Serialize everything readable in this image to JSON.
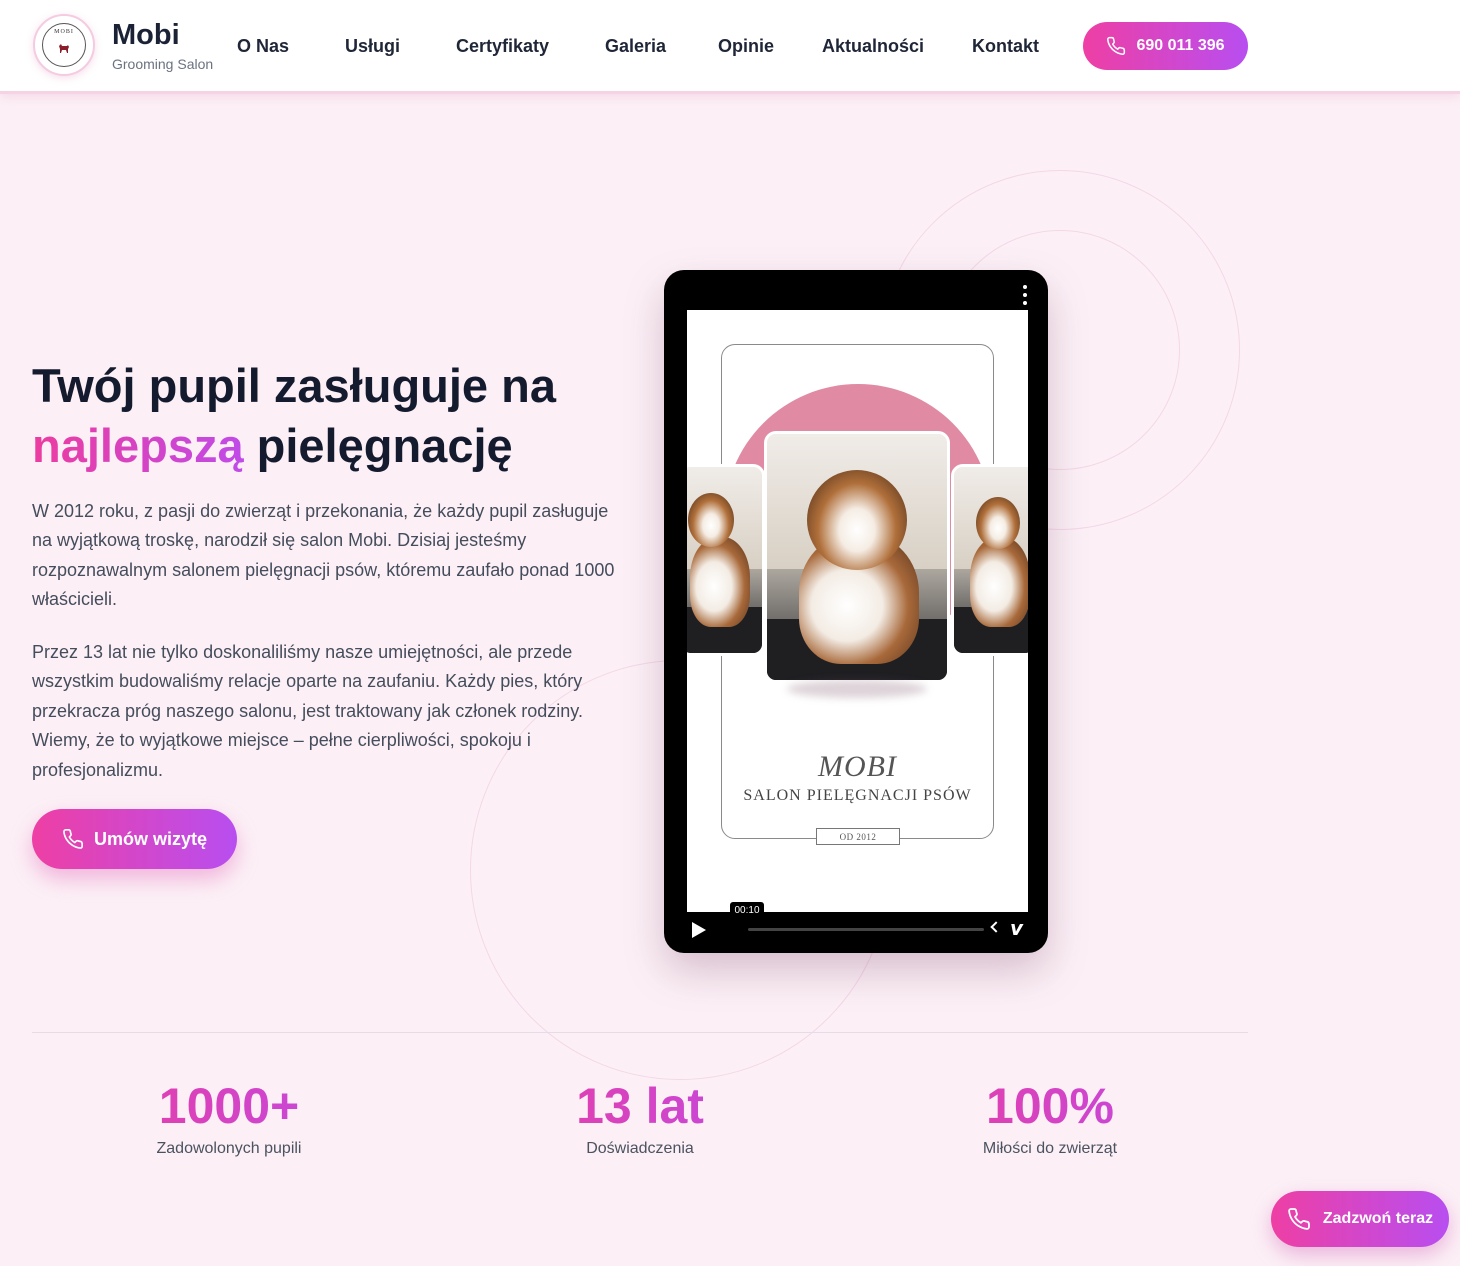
{
  "header": {
    "brand_name": "Mobi",
    "brand_sub": "Grooming Salon",
    "logo_text": "MOBI",
    "nav": [
      "O Nas",
      "Usługi",
      "Certyfikaty",
      "Galeria",
      "Opinie",
      "Aktualności",
      "Kontakt"
    ],
    "phone_label": "690 011 396",
    "phone_icon": "phone-icon"
  },
  "hero": {
    "title_line1": "Twój pupil zasługuje na",
    "title_accent": "najlepszą",
    "title_rest": " pielęgnację",
    "paragraph1": "W 2012 roku, z pasji do zwierząt i przekonania, że każdy pupil zasługuje na wyjątkową troskę, narodził się salon Mobi. Dzisiaj jesteśmy rozpoznawalnym salonem pielęgnacji psów, któremu zaufało ponad 1000 właścicieli.",
    "paragraph2": "Przez 13 lat nie tylko doskonaliliśmy nasze umiejętności, ale przede wszystkim budowaliśmy relacje oparte na zaufaniu. Każdy pies, który przekracza próg naszego salonu, jest traktowany jak członek rodziny. Wiemy, że to wyjątkowe miejsce – pełne cierpliwości, spokoju i profesjonalizmu.",
    "cta_label": "Umów wizytę"
  },
  "video": {
    "logo_title": "MOBI",
    "logo_subtitle": "SALON PIELĘGNACJI PSÓW",
    "since": "OD 2012",
    "time": "00:10",
    "progress": 0.0,
    "icons": [
      "play-icon",
      "more-vertical-icon",
      "back-icon",
      "vimeo-icon"
    ]
  },
  "stats": [
    {
      "value": "1000+",
      "label": "Zadowolonych pupili"
    },
    {
      "value": "13 lat",
      "label": "Doświadczenia"
    },
    {
      "value": "100%",
      "label": "Miłości do zwierząt"
    }
  ],
  "float_call": {
    "label": "Zadzwoń teraz"
  },
  "colors": {
    "accent_start": "#ee3fa4",
    "accent_end": "#b84ef0",
    "background": "#fcf0f6",
    "text_dark": "#151b2e"
  }
}
